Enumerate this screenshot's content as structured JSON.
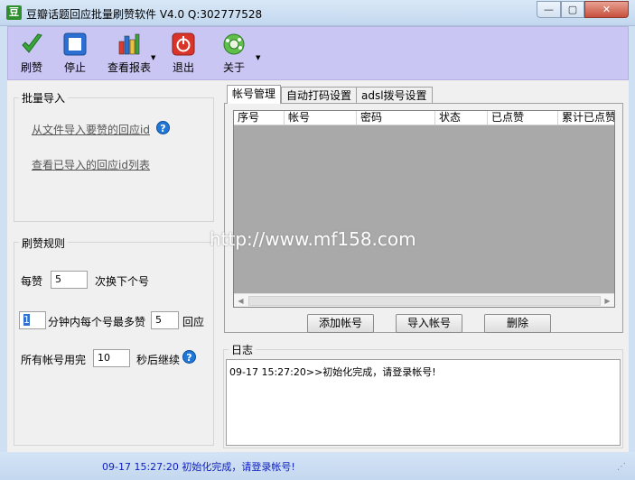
{
  "window": {
    "title": "豆瓣话题回应批量刷赞软件 V4.0   Q:302777528",
    "app_icon_glyph": "豆",
    "min_glyph": "—",
    "max_glyph": "▢",
    "close_glyph": "✕"
  },
  "toolbar": {
    "items": [
      {
        "label": "刷赞"
      },
      {
        "label": "停止"
      },
      {
        "label": "查看报表"
      },
      {
        "label": "退出"
      },
      {
        "label": "关于"
      }
    ],
    "dropdown_glyph": "▼"
  },
  "batch_import": {
    "title": "批量导入",
    "link_import": "从文件导入要赞的回应id",
    "link_view": "查看已导入的回应id列表",
    "help_glyph": "?"
  },
  "rules": {
    "title": "刷赞规则",
    "row1_prefix": "每赞",
    "row1_value": "5",
    "row1_suffix": "次换下个号",
    "row2_value_a": "1",
    "row2_middle": "分钟内每个号最多赞",
    "row2_value_b": "5",
    "row2_suffix": "回应",
    "row3_prefix": "所有帐号用完",
    "row3_value": "10",
    "row3_suffix": "秒后继续",
    "help_glyph": "?"
  },
  "tabs": [
    {
      "label": "帐号管理",
      "active": true
    },
    {
      "label": "自动打码设置",
      "active": false
    },
    {
      "label": "adsl拨号设置",
      "active": false
    }
  ],
  "account_table": {
    "columns": [
      "序号",
      "帐号",
      "密码",
      "状态",
      "已点赞",
      "累计已点赞"
    ],
    "rows": [],
    "scroll_left_glyph": "◀",
    "scroll_right_glyph": "▶"
  },
  "buttons": {
    "add": "添加帐号",
    "import": "导入帐号",
    "delete": "删除"
  },
  "log": {
    "title": "日志",
    "text": "09-17 15:27:20>>初始化完成，请登录帐号!"
  },
  "statusbar": {
    "text": "09-17 15:27:20 初始化完成，请登录帐号!"
  },
  "watermark": "http://www.mf158.com"
}
